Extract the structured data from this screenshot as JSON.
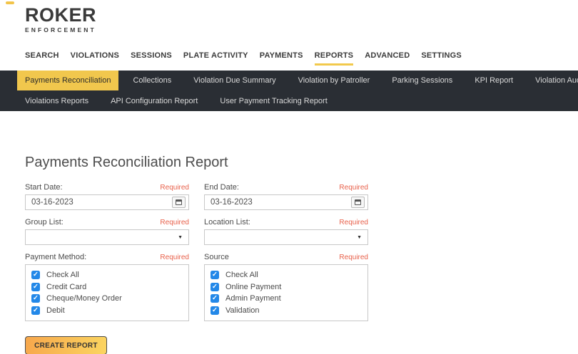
{
  "brand": {
    "name": "ROKER",
    "subtitle": "ENFORCEMENT",
    "accent_color": "#f2c449"
  },
  "main_nav": {
    "active": "REPORTS",
    "items": [
      "SEARCH",
      "VIOLATIONS",
      "SESSIONS",
      "PLATE ACTIVITY",
      "PAYMENTS",
      "REPORTS",
      "ADVANCED",
      "SETTINGS"
    ]
  },
  "sub_nav": {
    "active": "Payments Reconciliation",
    "bar_color": "#2a2e34",
    "active_bg": "#f1c74d",
    "row1": [
      "Payments Reconciliation",
      "Collections",
      "Violation Due Summary",
      "Violation by Patroller",
      "Parking Sessions",
      "KPI Report",
      "Violation Audit History"
    ],
    "row2": [
      "Violations Reports",
      "API Configuration Report",
      "User Payment Tracking Report"
    ]
  },
  "page": {
    "title": "Payments Reconciliation Report"
  },
  "form": {
    "required_label": "Required",
    "required_color": "#e8604a",
    "checkbox_color": "#2388e8",
    "start_date": {
      "label": "Start Date:",
      "value": "03-16-2023"
    },
    "end_date": {
      "label": "End Date:",
      "value": "03-16-2023"
    },
    "group_list": {
      "label": "Group List:",
      "value": ""
    },
    "location_list": {
      "label": "Location List:",
      "value": ""
    },
    "payment_method": {
      "label": "Payment Method:",
      "options": [
        "Check All",
        "Credit Card",
        "Cheque/Money Order",
        "Debit"
      ],
      "checked": [
        true,
        true,
        true,
        true
      ]
    },
    "source": {
      "label": "Source",
      "options": [
        "Check All",
        "Online Payment",
        "Admin Payment",
        "Validation"
      ],
      "checked": [
        true,
        true,
        true,
        true
      ]
    },
    "submit_label": "CREATE REPORT"
  }
}
